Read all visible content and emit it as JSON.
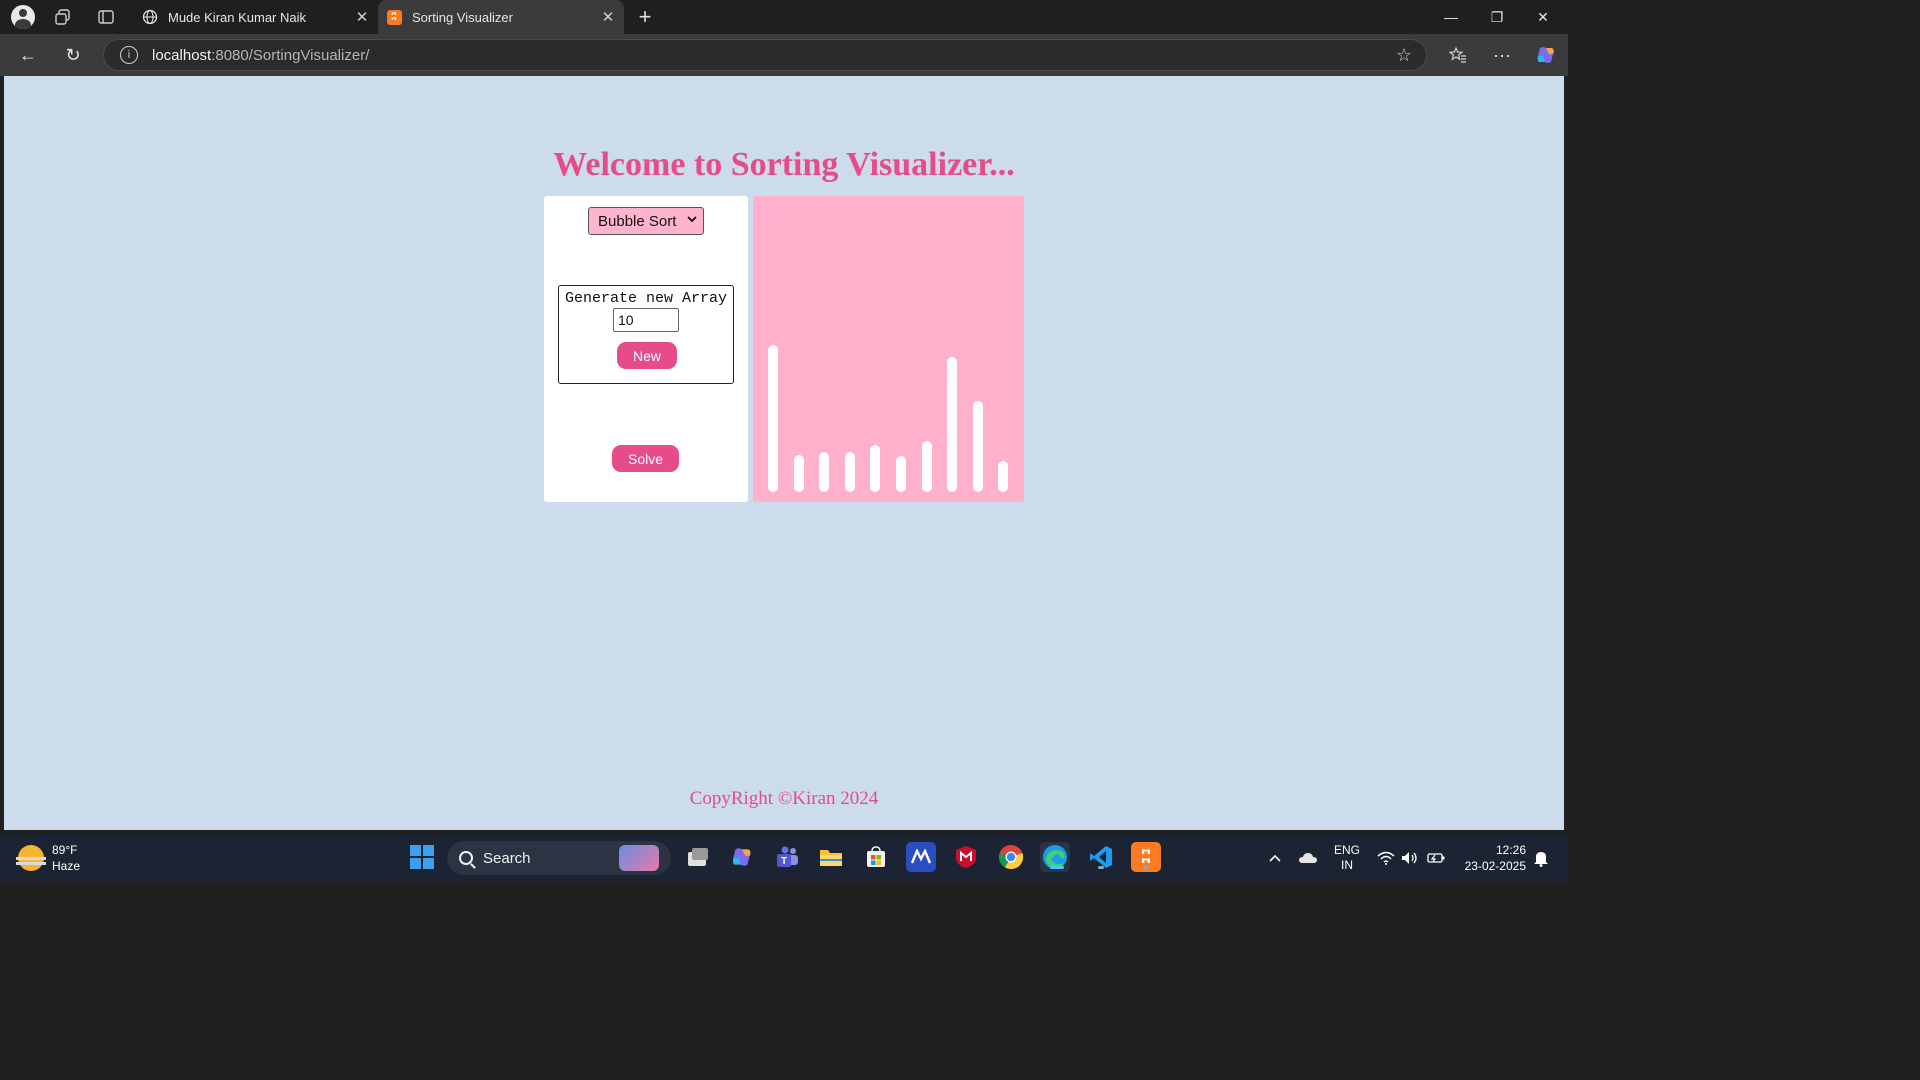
{
  "browser": {
    "tabs": [
      {
        "label": "Mude Kiran Kumar Naik",
        "favicon": "globe-icon"
      },
      {
        "label": "Sorting Visualizer",
        "favicon": "xampp-icon",
        "favicon_text": "ʭ"
      }
    ],
    "url_host": "localhost",
    "url_rest": ":8080/SortingVisualizer/"
  },
  "page": {
    "title": "Welcome to Sorting Visualizer...",
    "algorithm_selected": "Bubble Sort",
    "generate_label": "Generate new Array",
    "array_size": "10",
    "new_label": "New",
    "solve_label": "Solve",
    "copyright": "CopyRight ©Kiran 2024",
    "colors": {
      "accent": "#e64b8a",
      "panel_bg": "#ffb0cb",
      "page_bg": "#ccdcec",
      "select_bg": "#ffb3cf"
    },
    "array_values": [
      147,
      37,
      40,
      40,
      47,
      36,
      51,
      135,
      91,
      31
    ]
  },
  "taskbar": {
    "temperature": "89°F",
    "condition": "Haze",
    "search_label": "Search",
    "lang_top": "ENG",
    "lang_bottom": "IN",
    "time": "12:26",
    "date": "23-02-2025"
  }
}
